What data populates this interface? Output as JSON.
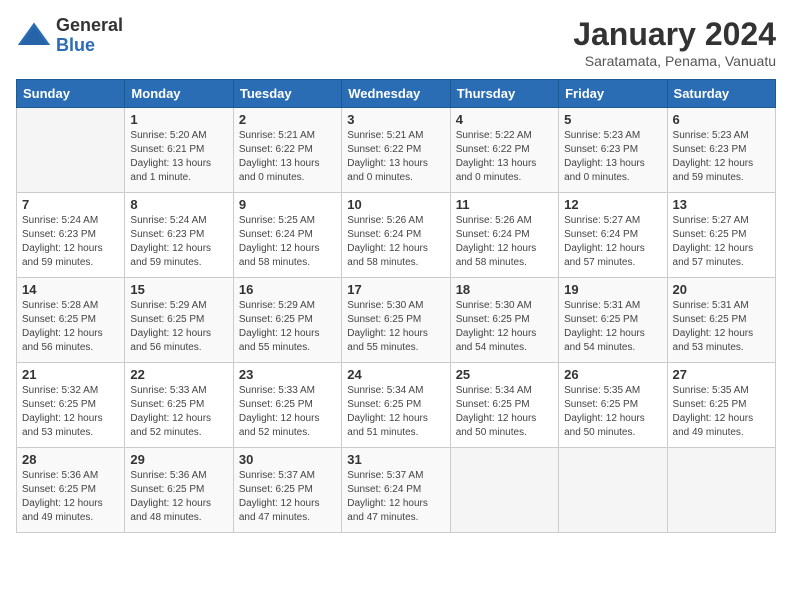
{
  "logo": {
    "general": "General",
    "blue": "Blue"
  },
  "title": "January 2024",
  "location": "Saratamata, Penama, Vanuatu",
  "days_of_week": [
    "Sunday",
    "Monday",
    "Tuesday",
    "Wednesday",
    "Thursday",
    "Friday",
    "Saturday"
  ],
  "weeks": [
    [
      {
        "day": "",
        "info": ""
      },
      {
        "day": "1",
        "info": "Sunrise: 5:20 AM\nSunset: 6:21 PM\nDaylight: 13 hours\nand 1 minute."
      },
      {
        "day": "2",
        "info": "Sunrise: 5:21 AM\nSunset: 6:22 PM\nDaylight: 13 hours\nand 0 minutes."
      },
      {
        "day": "3",
        "info": "Sunrise: 5:21 AM\nSunset: 6:22 PM\nDaylight: 13 hours\nand 0 minutes."
      },
      {
        "day": "4",
        "info": "Sunrise: 5:22 AM\nSunset: 6:22 PM\nDaylight: 13 hours\nand 0 minutes."
      },
      {
        "day": "5",
        "info": "Sunrise: 5:23 AM\nSunset: 6:23 PM\nDaylight: 13 hours\nand 0 minutes."
      },
      {
        "day": "6",
        "info": "Sunrise: 5:23 AM\nSunset: 6:23 PM\nDaylight: 12 hours\nand 59 minutes."
      }
    ],
    [
      {
        "day": "7",
        "info": "Sunrise: 5:24 AM\nSunset: 6:23 PM\nDaylight: 12 hours\nand 59 minutes."
      },
      {
        "day": "8",
        "info": "Sunrise: 5:24 AM\nSunset: 6:23 PM\nDaylight: 12 hours\nand 59 minutes."
      },
      {
        "day": "9",
        "info": "Sunrise: 5:25 AM\nSunset: 6:24 PM\nDaylight: 12 hours\nand 58 minutes."
      },
      {
        "day": "10",
        "info": "Sunrise: 5:26 AM\nSunset: 6:24 PM\nDaylight: 12 hours\nand 58 minutes."
      },
      {
        "day": "11",
        "info": "Sunrise: 5:26 AM\nSunset: 6:24 PM\nDaylight: 12 hours\nand 58 minutes."
      },
      {
        "day": "12",
        "info": "Sunrise: 5:27 AM\nSunset: 6:24 PM\nDaylight: 12 hours\nand 57 minutes."
      },
      {
        "day": "13",
        "info": "Sunrise: 5:27 AM\nSunset: 6:25 PM\nDaylight: 12 hours\nand 57 minutes."
      }
    ],
    [
      {
        "day": "14",
        "info": "Sunrise: 5:28 AM\nSunset: 6:25 PM\nDaylight: 12 hours\nand 56 minutes."
      },
      {
        "day": "15",
        "info": "Sunrise: 5:29 AM\nSunset: 6:25 PM\nDaylight: 12 hours\nand 56 minutes."
      },
      {
        "day": "16",
        "info": "Sunrise: 5:29 AM\nSunset: 6:25 PM\nDaylight: 12 hours\nand 55 minutes."
      },
      {
        "day": "17",
        "info": "Sunrise: 5:30 AM\nSunset: 6:25 PM\nDaylight: 12 hours\nand 55 minutes."
      },
      {
        "day": "18",
        "info": "Sunrise: 5:30 AM\nSunset: 6:25 PM\nDaylight: 12 hours\nand 54 minutes."
      },
      {
        "day": "19",
        "info": "Sunrise: 5:31 AM\nSunset: 6:25 PM\nDaylight: 12 hours\nand 54 minutes."
      },
      {
        "day": "20",
        "info": "Sunrise: 5:31 AM\nSunset: 6:25 PM\nDaylight: 12 hours\nand 53 minutes."
      }
    ],
    [
      {
        "day": "21",
        "info": "Sunrise: 5:32 AM\nSunset: 6:25 PM\nDaylight: 12 hours\nand 53 minutes."
      },
      {
        "day": "22",
        "info": "Sunrise: 5:33 AM\nSunset: 6:25 PM\nDaylight: 12 hours\nand 52 minutes."
      },
      {
        "day": "23",
        "info": "Sunrise: 5:33 AM\nSunset: 6:25 PM\nDaylight: 12 hours\nand 52 minutes."
      },
      {
        "day": "24",
        "info": "Sunrise: 5:34 AM\nSunset: 6:25 PM\nDaylight: 12 hours\nand 51 minutes."
      },
      {
        "day": "25",
        "info": "Sunrise: 5:34 AM\nSunset: 6:25 PM\nDaylight: 12 hours\nand 50 minutes."
      },
      {
        "day": "26",
        "info": "Sunrise: 5:35 AM\nSunset: 6:25 PM\nDaylight: 12 hours\nand 50 minutes."
      },
      {
        "day": "27",
        "info": "Sunrise: 5:35 AM\nSunset: 6:25 PM\nDaylight: 12 hours\nand 49 minutes."
      }
    ],
    [
      {
        "day": "28",
        "info": "Sunrise: 5:36 AM\nSunset: 6:25 PM\nDaylight: 12 hours\nand 49 minutes."
      },
      {
        "day": "29",
        "info": "Sunrise: 5:36 AM\nSunset: 6:25 PM\nDaylight: 12 hours\nand 48 minutes."
      },
      {
        "day": "30",
        "info": "Sunrise: 5:37 AM\nSunset: 6:25 PM\nDaylight: 12 hours\nand 47 minutes."
      },
      {
        "day": "31",
        "info": "Sunrise: 5:37 AM\nSunset: 6:24 PM\nDaylight: 12 hours\nand 47 minutes."
      },
      {
        "day": "",
        "info": ""
      },
      {
        "day": "",
        "info": ""
      },
      {
        "day": "",
        "info": ""
      }
    ]
  ]
}
